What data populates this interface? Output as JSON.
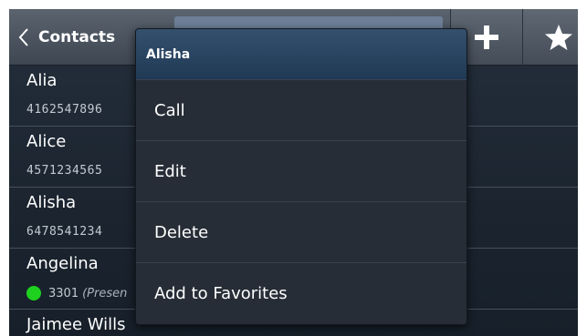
{
  "header": {
    "back_label": "Contacts",
    "add_button": "add-icon",
    "favorites_button": "star-icon"
  },
  "contacts": [
    {
      "name": "Alia",
      "number": "4162547896"
    },
    {
      "name": "Alice",
      "number": "4571234565"
    },
    {
      "name": "Alisha",
      "number": "6478541234"
    },
    {
      "name": "Angelina",
      "number": "3301",
      "presence": "(Presen"
    },
    {
      "name": "Jaimee Wills"
    }
  ],
  "context_menu": {
    "title": "Alisha",
    "items": [
      "Call",
      "Edit",
      "Delete",
      "Add to Favorites"
    ]
  },
  "colors": {
    "presence_online": "#1fd11f",
    "menu_header": "#2b4763"
  }
}
